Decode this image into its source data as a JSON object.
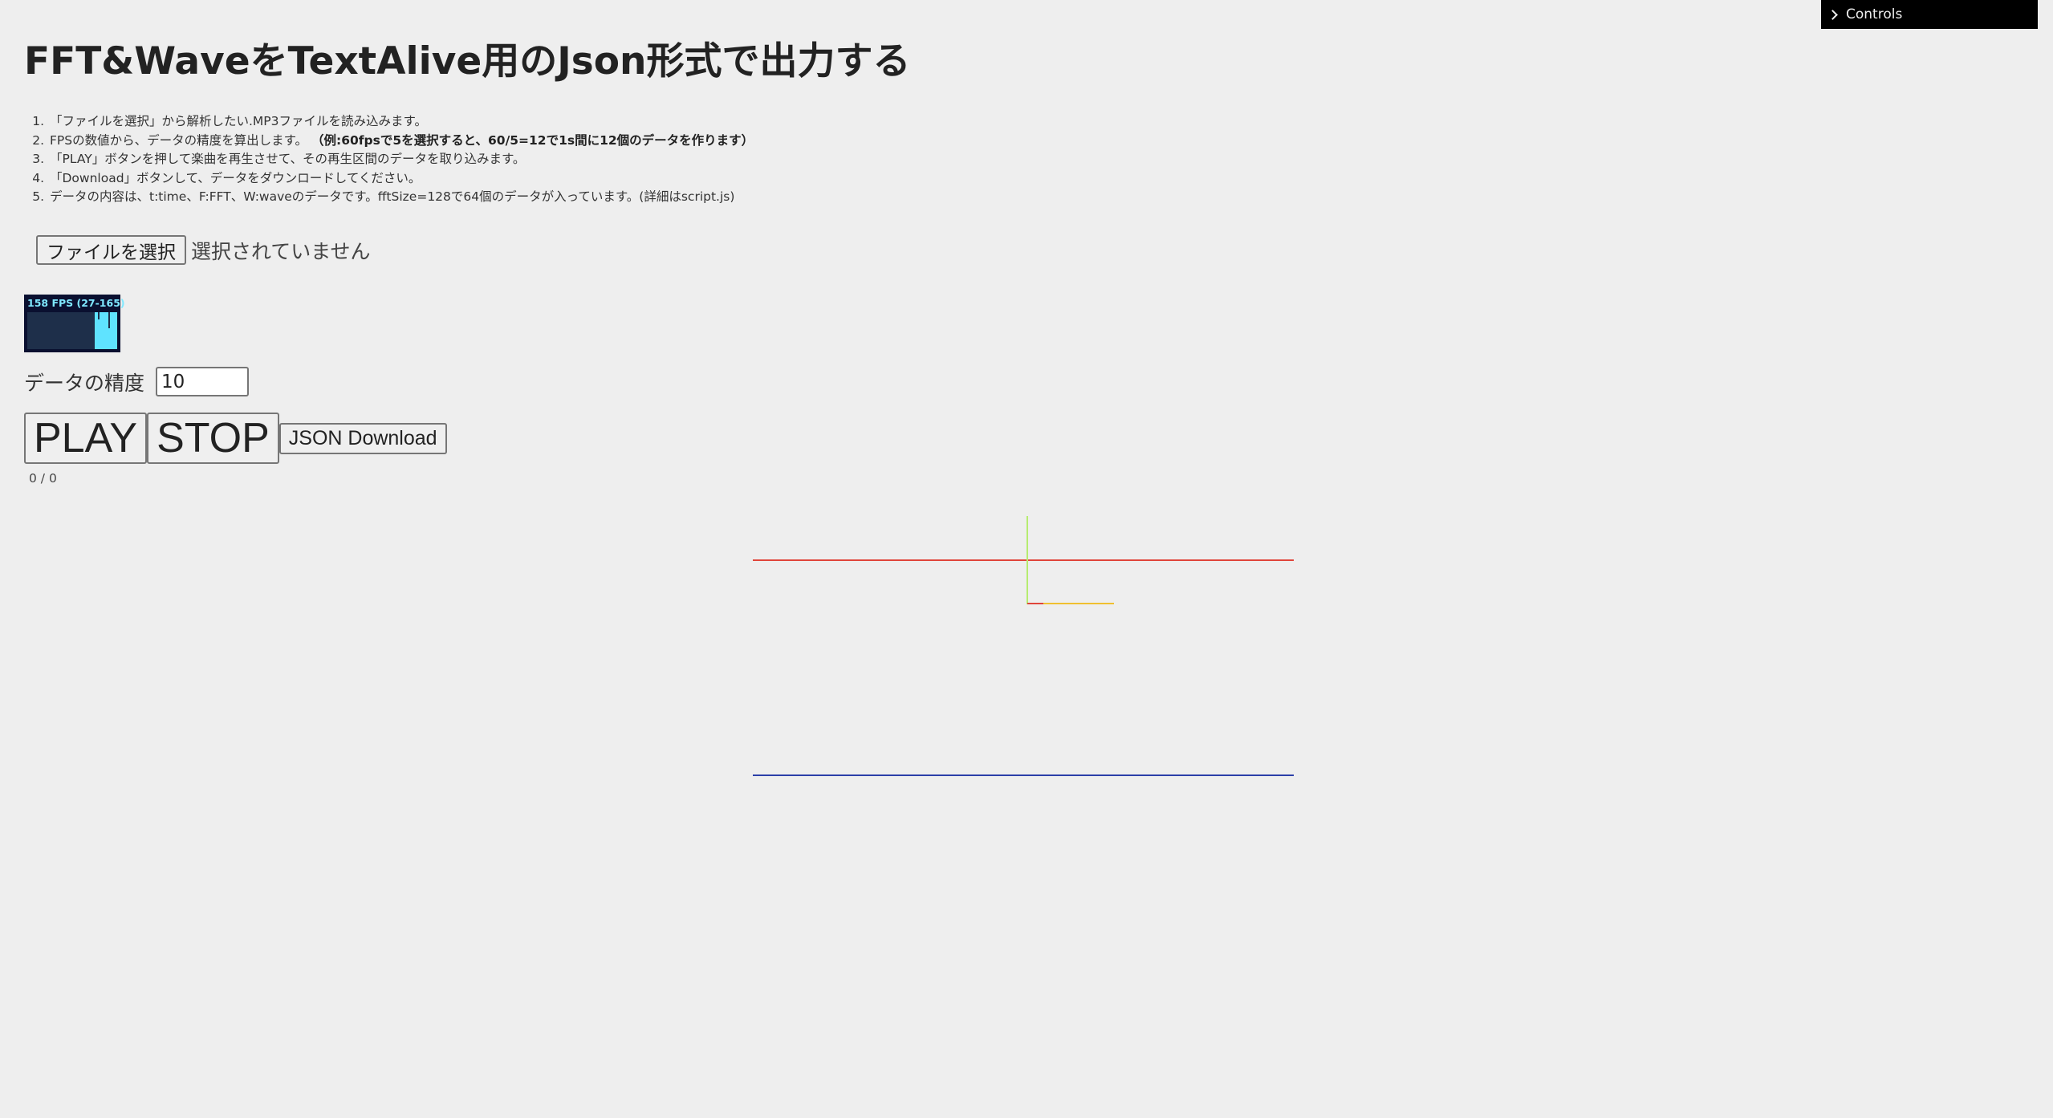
{
  "page": {
    "title": "FFT&WaveをTextAlive用のJson形式で出力する"
  },
  "instructions": {
    "steps": [
      "「ファイルを選択」から解析したい.MP3ファイルを読み込みます。",
      "FPSの数値から、データの精度を算出します。",
      "「PLAY」ボタンを押して楽曲を再生させて、その再生区間のデータを取り込みます。",
      "「Download」ボタンして、データをダウンロードしてください。",
      "データの内容は、t:time、F:FFT、W:waveのデータです。fftSize=128で64個のデータが入っています。(詳細はscript.js)"
    ],
    "step2_note": "（例:60fpsで5を選択すると、60/5=12で1s間に12個のデータを作ります）"
  },
  "file_input": {
    "button_label": "ファイルを選択",
    "status": "選択されていません"
  },
  "stats": {
    "label": "158 FPS (27-165)"
  },
  "precision": {
    "label": "データの精度",
    "value": "10"
  },
  "controls": {
    "play_label": "PLAY",
    "stop_label": "STOP",
    "download_label": "JSON Download"
  },
  "playback": {
    "time_readout": "0 / 0"
  },
  "gui": {
    "controls_label": "Controls"
  },
  "colors": {
    "background": "#eeeeee",
    "waveform_line": "#e0453a",
    "fft_line": "#2b3fa8",
    "axis_x": "#e0453a",
    "axis_y": "#9be84a",
    "axis_z": "#f0c030",
    "stats_bg": "#0a1030",
    "stats_fg": "#5fe3ff"
  }
}
